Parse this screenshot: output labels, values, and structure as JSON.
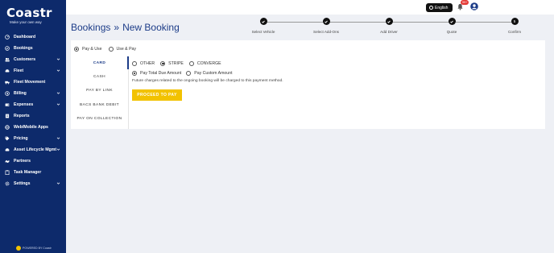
{
  "brand": {
    "logo_text": "Coastr",
    "tagline": "Make your own way",
    "powered_by": "POWERED BY Coastr"
  },
  "sidebar": {
    "items": [
      {
        "label": "Dashboard",
        "icon": "dashboard-icon",
        "has_chevron": false
      },
      {
        "label": "Bookings",
        "icon": "bookings-icon",
        "has_chevron": false
      },
      {
        "label": "Customers",
        "icon": "customers-icon",
        "has_chevron": true
      },
      {
        "label": "Fleet",
        "icon": "car-icon",
        "has_chevron": true
      },
      {
        "label": "Fleet Movement",
        "icon": "truck-icon",
        "has_chevron": false
      },
      {
        "label": "Billing",
        "icon": "billing-icon",
        "has_chevron": true
      },
      {
        "label": "Expenses",
        "icon": "wallet-icon",
        "has_chevron": true
      },
      {
        "label": "Reports",
        "icon": "reports-icon",
        "has_chevron": false
      },
      {
        "label": "Web/Mobile Apps",
        "icon": "globe-icon",
        "has_chevron": false
      },
      {
        "label": "Pricing",
        "icon": "tag-icon",
        "has_chevron": true
      },
      {
        "label": "Asset Lifecycle Mgmt",
        "icon": "car-icon",
        "has_chevron": true
      },
      {
        "label": "Partners",
        "icon": "handshake-icon",
        "has_chevron": false
      },
      {
        "label": "Task Manager",
        "icon": "clipboard-icon",
        "has_chevron": false
      },
      {
        "label": "Settings",
        "icon": "gear-icon",
        "has_chevron": true
      }
    ]
  },
  "topbar": {
    "language": "English",
    "notification_count": "99+"
  },
  "header": {
    "crumb_1": "Bookings",
    "separator": "»",
    "crumb_2": "New Booking"
  },
  "stepper": {
    "steps": [
      {
        "label": "Select Vehicle",
        "state": "done"
      },
      {
        "label": "Select Add-Ons",
        "state": "done"
      },
      {
        "label": "Add Driver",
        "state": "done"
      },
      {
        "label": "Quote",
        "state": "done"
      },
      {
        "label": "Confirm",
        "state": "current",
        "number": "5"
      }
    ]
  },
  "payment": {
    "modes": [
      {
        "label": "Pay & Use",
        "selected": true
      },
      {
        "label": "Use & Pay",
        "selected": false
      }
    ],
    "methods": [
      {
        "label": "CARD",
        "active": true
      },
      {
        "label": "CASH",
        "active": false
      },
      {
        "label": "PAY BY LINK",
        "active": false
      },
      {
        "label": "BACS BANK DEBIT",
        "active": false
      },
      {
        "label": "PAY ON COLLECTION",
        "active": false
      }
    ],
    "gateways": [
      {
        "label": "OTHER",
        "selected": false
      },
      {
        "label": "STRIPE",
        "selected": true
      },
      {
        "label": "CONVERGE",
        "selected": false
      }
    ],
    "amount_options": [
      {
        "label": "Pay Total Due Amount",
        "selected": true
      },
      {
        "label": "Pay Custom Amount",
        "selected": false
      }
    ],
    "note": "Future charges related to the ongoing booking will be charged to this payment method.",
    "proceed_label": "PROCEED TO PAY"
  },
  "colors": {
    "sidebar_bg": "#0d2a6b",
    "accent_blue": "#1c3c88",
    "button_yellow": "#f2c200",
    "badge_red": "#e53935"
  }
}
